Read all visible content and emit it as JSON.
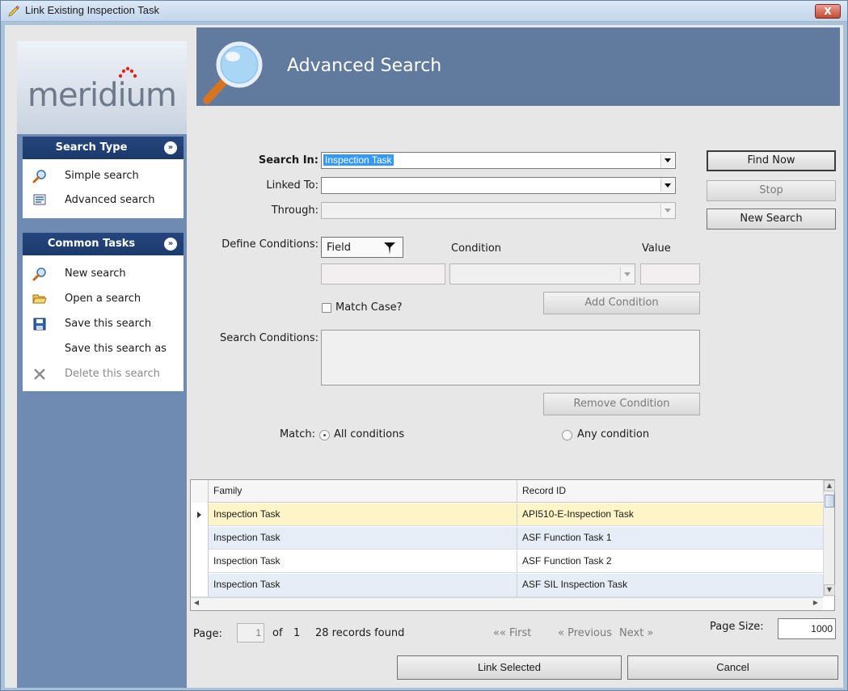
{
  "window": {
    "title": "Link Existing Inspection Task",
    "close_label": "X"
  },
  "logo": {
    "text": "meridium"
  },
  "banner": {
    "title": "Advanced Search"
  },
  "search_type": {
    "header": "Search Type",
    "items": [
      {
        "label": "Simple search",
        "icon": "magnifier-icon"
      },
      {
        "label": "Advanced search",
        "icon": "advanced-search-icon"
      }
    ]
  },
  "common_tasks": {
    "header": "Common Tasks",
    "items": [
      {
        "label": "New search",
        "icon": "magnifier-icon"
      },
      {
        "label": "Open a search",
        "icon": "folder-open-icon"
      },
      {
        "label": "Save this search",
        "icon": "floppy-disk-icon"
      },
      {
        "label": "Save this search as",
        "icon": ""
      },
      {
        "label": "Delete this search",
        "icon": "delete-x-icon",
        "disabled": true
      }
    ]
  },
  "form": {
    "search_in_label": "Search In:",
    "search_in_value": "Inspection Task",
    "linked_to_label": "Linked To:",
    "linked_to_value": "",
    "through_label": "Through:",
    "through_value": "",
    "define_conditions_label": "Define Conditions:",
    "field_label": "Field",
    "condition_label": "Condition",
    "value_label": "Value",
    "match_case_label": "Match Case?",
    "add_condition": "Add Condition",
    "search_conditions_label": "Search Conditions:",
    "remove_condition": "Remove Condition",
    "match_label": "Match:",
    "all_conditions": "All conditions",
    "any_condition": "Any condition"
  },
  "actions": {
    "find_now": "Find Now",
    "stop": "Stop",
    "new_search": "New Search"
  },
  "grid": {
    "columns": [
      "Family",
      "Record ID"
    ],
    "rows": [
      {
        "family": "Inspection Task",
        "record_id": "API510-E-Inspection Task"
      },
      {
        "family": "Inspection Task",
        "record_id": "ASF Function Task 1"
      },
      {
        "family": "Inspection Task",
        "record_id": "ASF Function Task 2"
      },
      {
        "family": "Inspection Task",
        "record_id": "ASF SIL Inspection Task"
      }
    ]
  },
  "pager": {
    "page_label": "Page:",
    "page_value": "1",
    "of_label": "of",
    "total_pages": "1",
    "records_found": "28 records found",
    "first": "«« First",
    "previous": "« Previous",
    "next": "Next »",
    "page_size_label": "Page Size:",
    "page_size_value": "1000"
  },
  "footer": {
    "link_selected": "Link Selected",
    "cancel": "Cancel"
  },
  "colors": {
    "banner": "#607b9d",
    "task_header": "#1c3a6b",
    "sidebar": "#6f8bb1",
    "selected_row": "#fdf5c8",
    "alt_row": "#e6edf7"
  }
}
